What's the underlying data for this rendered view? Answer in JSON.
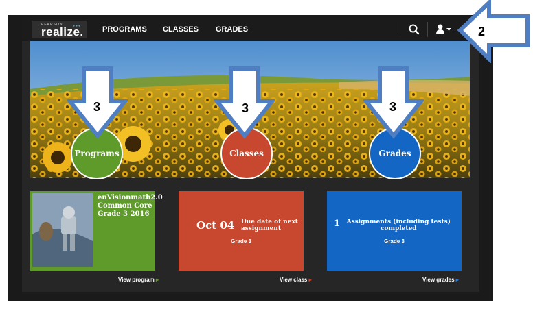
{
  "brand": {
    "sub": "PEARSON",
    "name": "realize."
  },
  "nav": {
    "items": [
      "PROGRAMS",
      "CLASSES",
      "GRADES"
    ]
  },
  "circles": [
    "Programs",
    "Classes",
    "Grades"
  ],
  "colors": {
    "programs": "#5e9b2a",
    "classes": "#c7482e",
    "grades": "#1466c4"
  },
  "tiles": {
    "program": {
      "title_lines": [
        "enVisionmath2.0",
        "Common Core",
        "Grade 3 2016"
      ],
      "link": "View program"
    },
    "class": {
      "date": "Oct 04",
      "desc_lines": [
        "Due date of next",
        "assignment"
      ],
      "grade": "Grade 3",
      "link": "View class"
    },
    "grades": {
      "count": "1",
      "desc_lines": [
        "Assignments (including tests)",
        "completed"
      ],
      "grade": "Grade 3",
      "link": "View grades"
    }
  },
  "annotations": [
    "2",
    "3",
    "3",
    "3"
  ]
}
